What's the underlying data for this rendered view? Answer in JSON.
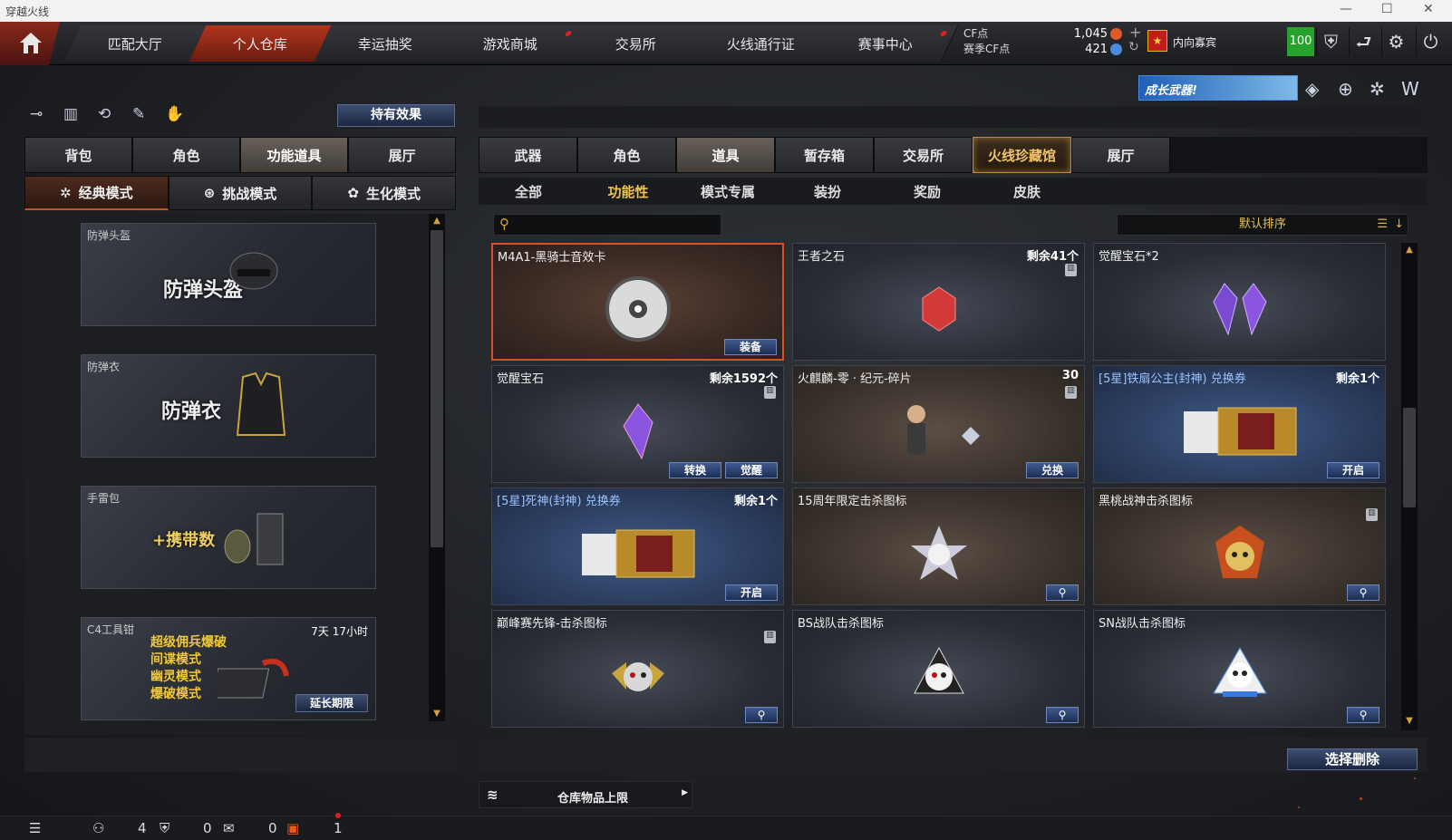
{
  "window": {
    "title": "穿越火线"
  },
  "nav": {
    "tabs": [
      {
        "label": "匹配大厅"
      },
      {
        "label": "个人仓库",
        "active": true
      },
      {
        "label": "幸运抽奖"
      },
      {
        "label": "游戏商城",
        "dot": true
      },
      {
        "label": "交易所"
      },
      {
        "label": "火线通行证"
      },
      {
        "label": "赛事中心",
        "dot": true
      }
    ]
  },
  "currency": {
    "cf_label": "CF点",
    "cf_value": "1,045",
    "season_label": "赛季CF点",
    "season_value": "421"
  },
  "user": {
    "name": "内向寡宾",
    "level": "100"
  },
  "banner": {
    "text": "成长武器!"
  },
  "left": {
    "effects_button": "持有效果",
    "tabs": [
      {
        "label": "背包"
      },
      {
        "label": "角色"
      },
      {
        "label": "功能道具",
        "active": true
      },
      {
        "label": "展厅"
      }
    ],
    "modes": [
      {
        "label": "经典模式",
        "active": true
      },
      {
        "label": "挑战模式"
      },
      {
        "label": "生化模式"
      }
    ],
    "items": [
      {
        "name": "防弹头盔",
        "art": "防弹头盔",
        "extra": ""
      },
      {
        "name": "防弹衣",
        "art": "防弹衣",
        "extra": ""
      },
      {
        "name": "手雷包",
        "art": "+携带数",
        "extra": ""
      },
      {
        "name": "C4工具钳",
        "art": "超级佣兵爆破\n间谍模式\n幽灵模式\n爆破模式",
        "extra": "7天 17小时",
        "button": "延长期限"
      }
    ]
  },
  "right": {
    "tabs": [
      {
        "label": "武器"
      },
      {
        "label": "角色"
      },
      {
        "label": "道具",
        "active": true
      },
      {
        "label": "暂存箱"
      },
      {
        "label": "交易所"
      },
      {
        "label": "火线珍藏馆",
        "gold": true
      },
      {
        "label": "展厅"
      }
    ],
    "subtabs": [
      {
        "label": "全部"
      },
      {
        "label": "功能性",
        "active": true
      },
      {
        "label": "模式专属"
      },
      {
        "label": "装扮"
      },
      {
        "label": "奖励"
      },
      {
        "label": "皮肤"
      }
    ],
    "sort_label": "默认排序",
    "items": [
      {
        "name": "M4A1-黑骑士音效卡",
        "count": "",
        "style": "sel",
        "icon": "cd-icon",
        "buttons": [
          "装备"
        ]
      },
      {
        "name": "王者之石",
        "count": "剩余41个",
        "style": "",
        "icon": "ruby-icon",
        "trash": true
      },
      {
        "name": "觉醒宝石*2",
        "count": "",
        "style": "",
        "icon": "gems-icon"
      },
      {
        "name": "觉醒宝石",
        "count": "剩余1592个",
        "style": "",
        "icon": "gem-icon",
        "trash": true,
        "buttons": [
          "转换",
          "觉醒"
        ]
      },
      {
        "name": "火麒麟-零 · 纪元-碎片",
        "count": "30",
        "style": "brown",
        "icon": "character-icon",
        "trash": true,
        "buttons": [
          "兑换"
        ]
      },
      {
        "name": "[5星]铁扇公主(封神) 兑换券",
        "count": "剩余1个",
        "style": "blue",
        "icon": "ticket-icon",
        "buttons": [
          "开启"
        ]
      },
      {
        "name": "[5星]死神(封神) 兑换券",
        "count": "剩余1个",
        "style": "blue",
        "icon": "ticket-icon",
        "buttons": [
          "开启"
        ]
      },
      {
        "name": "15周年限定击杀图标",
        "count": "",
        "style": "brown",
        "icon": "skull-star-icon",
        "mag": true
      },
      {
        "name": "黑桃战神击杀图标",
        "count": "",
        "style": "brown",
        "icon": "skull-gold-icon",
        "trash": true,
        "mag": true
      },
      {
        "name": "巅峰赛先锋-击杀图标",
        "count": "",
        "style": "",
        "icon": "skull-wings-icon",
        "trash": true,
        "mag": true
      },
      {
        "name": "BS战队击杀图标",
        "count": "",
        "style": "",
        "icon": "skull-red-icon",
        "mag": true
      },
      {
        "name": "SN战队击杀图标",
        "count": "",
        "style": "",
        "icon": "skull-blue-icon",
        "mag": true
      }
    ],
    "delete_button": "选择删除",
    "capacity_label": "仓库物品上限"
  },
  "statusbar": {
    "v1": "4",
    "v2": "0",
    "v3": "0",
    "v4": "1"
  }
}
